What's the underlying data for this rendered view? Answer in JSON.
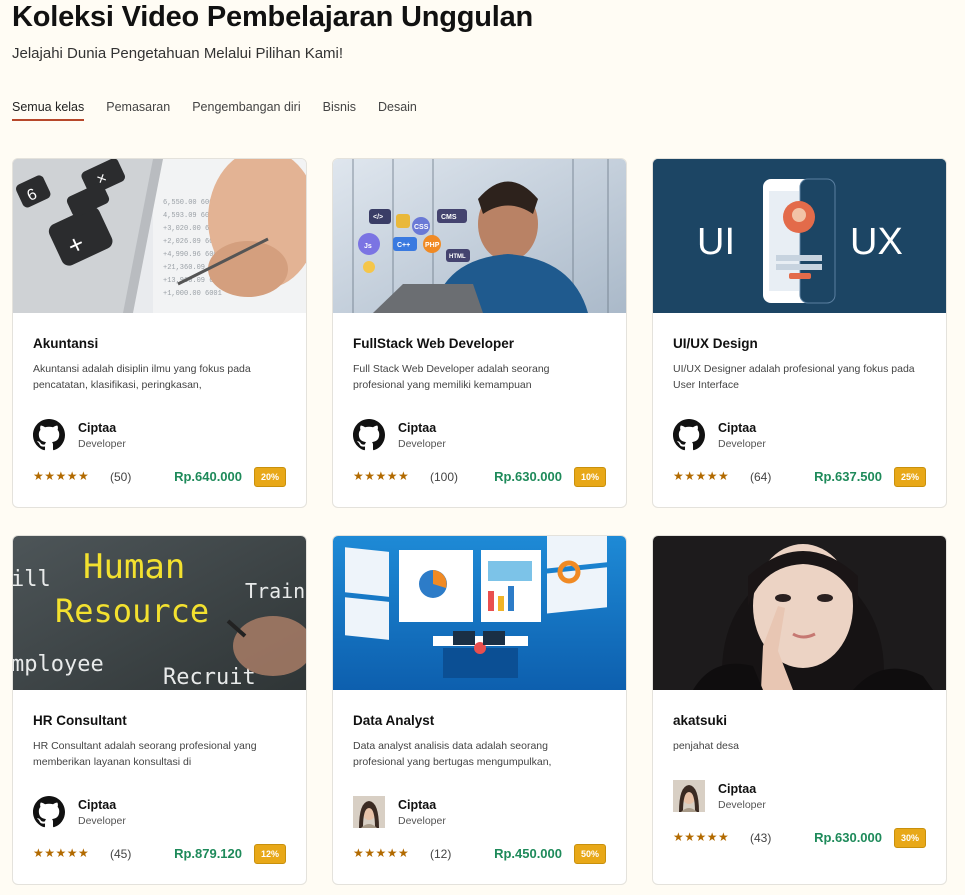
{
  "header": {
    "title": "Koleksi Video Pembelajaran Unggulan",
    "subtitle": "Jelajahi Dunia Pengetahuan Melalui Pilihan Kami!"
  },
  "tabs": [
    {
      "label": "Semua kelas",
      "active": true
    },
    {
      "label": "Pemasaran",
      "active": false
    },
    {
      "label": "Pengembangan diri",
      "active": false
    },
    {
      "label": "Bisnis",
      "active": false
    },
    {
      "label": "Desain",
      "active": false
    }
  ],
  "courses": [
    {
      "title": "Akuntansi",
      "desc": "Akuntansi adalah disiplin ilmu yang fokus pada pencatatan, klasifikasi, peringkasan,",
      "author": "Ciptaa",
      "role": "Developer",
      "stars": "★★★★★",
      "reviews": "(50)",
      "price": "Rp.640.000",
      "discount": "20%",
      "avatar": "github-icon"
    },
    {
      "title": "FullStack Web Developer",
      "desc": "Full Stack Web Developer adalah seorang profesional yang memiliki kemampuan",
      "author": "Ciptaa",
      "role": "Developer",
      "stars": "★★★★★",
      "reviews": "(100)",
      "price": "Rp.630.000",
      "discount": "10%",
      "avatar": "github-icon"
    },
    {
      "title": "UI/UX Design",
      "desc": "UI/UX Designer adalah profesional yang fokus pada User Interface",
      "author": "Ciptaa",
      "role": "Developer",
      "stars": "★★★★★",
      "reviews": "(64)",
      "price": "Rp.637.500",
      "discount": "25%",
      "avatar": "github-icon"
    },
    {
      "title": "HR Consultant",
      "desc": "HR Consultant adalah seorang profesional yang memberikan layanan konsultasi di",
      "author": "Ciptaa",
      "role": "Developer",
      "stars": "★★★★★",
      "reviews": "(45)",
      "price": "Rp.879.120",
      "discount": "12%",
      "avatar": "github-icon"
    },
    {
      "title": "Data Analyst",
      "desc": "Data analyst analisis data adalah seorang profesional yang bertugas mengumpulkan,",
      "author": "Ciptaa",
      "role": "Developer",
      "stars": "★★★★★",
      "reviews": "(12)",
      "price": "Rp.450.000",
      "discount": "50%",
      "avatar": "photo-avatar"
    },
    {
      "title": "akatsuki",
      "desc": "penjahat desa",
      "author": "Ciptaa",
      "role": "Developer",
      "stars": "★★★★★",
      "reviews": "(43)",
      "price": "Rp.630.000",
      "discount": "30%",
      "avatar": "photo-avatar"
    }
  ],
  "thumbnails": {
    "uiux_left": "UI",
    "uiux_right": "UX",
    "hr_line1": "Human",
    "hr_line2": "Resource",
    "hr_train": "Train",
    "hr_recruit": "Recruit",
    "hr_employee": "mployee",
    "hr_ill": "ill",
    "code_tags": [
      "</>",
      "CSS",
      "CMS",
      "Js",
      "C++",
      "PHP",
      "HTML"
    ]
  },
  "colors": {
    "accent": "#b7472a",
    "price": "#1e8a5a",
    "badge": "#e8a818",
    "star": "#b26a00",
    "uiux_bg": "#1c4564"
  }
}
